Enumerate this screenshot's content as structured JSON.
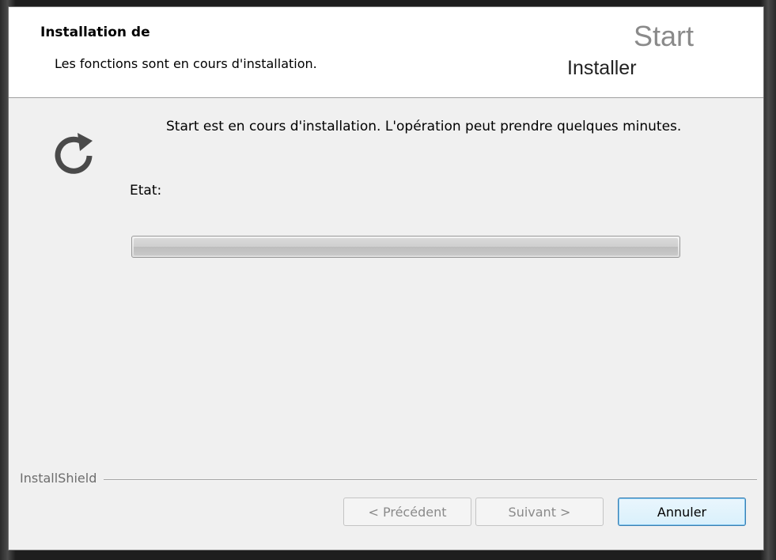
{
  "dialog": {
    "title": "Installation de",
    "subtitle": "Les fonctions sont en cours d'installation.",
    "brand_top": "Start",
    "brand_bottom": "Installer"
  },
  "content": {
    "status_line": "Start est en cours d'installation. L'opération peut prendre quelques minutes.",
    "etat_label": "Etat:",
    "progress_value": 0
  },
  "footer": {
    "vendor": "InstallShield",
    "back_label": "< Précédent",
    "next_label": "Suivant >",
    "cancel_label": "Annuler"
  },
  "icons": {
    "main": "refresh-icon"
  }
}
